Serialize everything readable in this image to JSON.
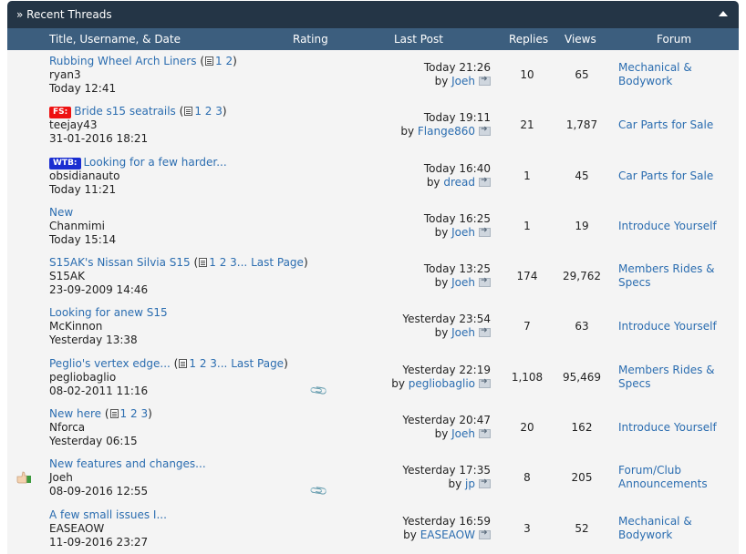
{
  "header": {
    "title": "» Recent Threads"
  },
  "columns": {
    "title": "Title, Username, & Date",
    "rating": "Rating",
    "last_post": "Last Post",
    "replies": "Replies",
    "views": "Views",
    "forum": "Forum"
  },
  "icons": {
    "collapse": "collapse-arrow-icon",
    "multipage": "multipage-icon",
    "goto": "goto-last-post-icon",
    "attachment": "paperclip-icon",
    "thumbs_up": "thumbs-up-icon"
  },
  "colors": {
    "titlebar_bg": "#243546",
    "header_bg": "#3c5e7e",
    "link": "#2b6db0",
    "fs_tag": "#e11111",
    "wtb_tag": "#1a2ed1"
  },
  "threads": [
    {
      "title": "Rubbing Wheel Arch Liners",
      "pages": [
        "1",
        "2"
      ],
      "last_page": "",
      "prefix": "",
      "author": "ryan3",
      "date": "Today 12:41",
      "last_time": "Today 21:26",
      "by": "by",
      "last_user": "Joeh",
      "replies": "10",
      "views": "65",
      "forum": "Mechanical & Bodywork"
    },
    {
      "title": "Bride s15 seatrails",
      "pages": [
        "1",
        "2",
        "3"
      ],
      "last_page": "",
      "prefix": "FS:",
      "author": "teejay43",
      "date": "31-01-2016 18:21",
      "last_time": "Today 19:11",
      "by": "by",
      "last_user": "Flange860",
      "replies": "21",
      "views": "1,787",
      "forum": "Car Parts for Sale"
    },
    {
      "title": "Looking for a few harder...",
      "pages": [],
      "last_page": "",
      "prefix": "WTB:",
      "author": "obsidianauto",
      "date": "Today 11:21",
      "last_time": "Today 16:40",
      "by": "by",
      "last_user": "dread",
      "replies": "1",
      "views": "45",
      "forum": "Car Parts for Sale"
    },
    {
      "title": "New",
      "pages": [],
      "last_page": "",
      "prefix": "",
      "author": "Chanmimi",
      "date": "Today 15:14",
      "last_time": "Today 16:25",
      "by": "by",
      "last_user": "Joeh",
      "replies": "1",
      "views": "19",
      "forum": "Introduce Yourself"
    },
    {
      "title": "S15AK's Nissan Silvia S15",
      "pages": [
        "1",
        "2",
        "3..."
      ],
      "last_page": "Last Page",
      "prefix": "",
      "author": "S15AK",
      "date": "23-09-2009 14:46",
      "last_time": "Today 13:25",
      "by": "by",
      "last_user": "Joeh",
      "replies": "174",
      "views": "29,762",
      "forum": "Members Rides & Specs"
    },
    {
      "title": "Looking for anew S15",
      "pages": [],
      "last_page": "",
      "prefix": "",
      "author": "McKinnon",
      "date": "Yesterday 13:38",
      "last_time": "Yesterday 23:54",
      "by": "by",
      "last_user": "Joeh",
      "replies": "7",
      "views": "63",
      "forum": "Introduce Yourself"
    },
    {
      "title": "Peglio's vertex edge...",
      "pages": [
        "1",
        "2",
        "3..."
      ],
      "last_page": "Last Page",
      "prefix": "",
      "author": "pegliobaglio",
      "date": "08-02-2011 11:16",
      "last_time": "Yesterday 22:19",
      "by": "by",
      "last_user": "pegliobaglio",
      "replies": "1,108",
      "views": "95,469",
      "forum": "Members Rides & Specs"
    },
    {
      "title": "New here",
      "pages": [
        "1",
        "2",
        "3"
      ],
      "last_page": "",
      "prefix": "",
      "author": "Nforca",
      "date": "Yesterday 06:15",
      "last_time": "Yesterday 20:47",
      "by": "by",
      "last_user": "Joeh",
      "replies": "20",
      "views": "162",
      "forum": "Introduce Yourself"
    },
    {
      "title": "New features and changes...",
      "pages": [],
      "last_page": "",
      "prefix": "",
      "author": "Joeh",
      "date": "08-09-2016 12:55",
      "last_time": "Yesterday 17:35",
      "by": "by",
      "last_user": "jp",
      "replies": "8",
      "views": "205",
      "forum": "Forum/Club Announcements"
    },
    {
      "title": "A few small issues I...",
      "pages": [],
      "last_page": "",
      "prefix": "",
      "author": "EASEAOW",
      "date": "11-09-2016 23:27",
      "last_time": "Yesterday 16:59",
      "by": "by",
      "last_user": "EASEAOW",
      "replies": "3",
      "views": "52",
      "forum": "Mechanical & Bodywork"
    }
  ]
}
